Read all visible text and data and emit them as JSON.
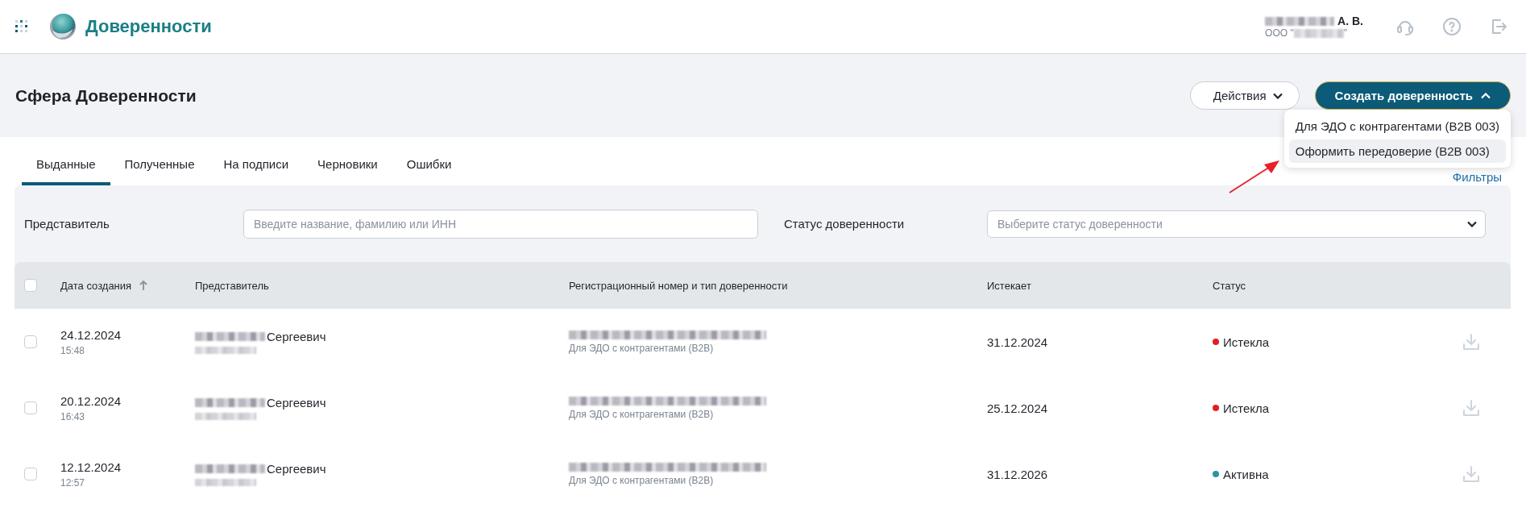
{
  "header": {
    "app_title": "Доверенности",
    "user": {
      "name": "А. В.",
      "org_prefix": "ООО \"",
      "org_suffix": "\""
    }
  },
  "page_title": "Сфера Доверенности",
  "actions_button": {
    "label": "Действия"
  },
  "create_button": {
    "label": "Создать доверенность",
    "expanded": true
  },
  "create_menu": [
    {
      "label": "Для ЭДО с контрагентами (B2B 003)",
      "selected": false
    },
    {
      "label": "Оформить передоверие (B2B 003)",
      "selected": true
    }
  ],
  "tabs": [
    {
      "label": "Выданные",
      "selected": true
    },
    {
      "label": "Полученные",
      "selected": false
    },
    {
      "label": "На подписи",
      "selected": false
    },
    {
      "label": "Черновики",
      "selected": false
    },
    {
      "label": "Ошибки",
      "selected": false
    }
  ],
  "filters_link": "Фильтры",
  "filters": {
    "representative": {
      "label": "Представитель",
      "placeholder": "Введите название, фамилию или ИНН"
    },
    "status": {
      "label": "Статус доверенности",
      "placeholder": "Выберите статус доверенности"
    }
  },
  "table": {
    "select_all_checked": false,
    "columns": [
      {
        "label": "Дата создания",
        "sorted": true
      },
      {
        "label": "Представитель",
        "sorted": false
      },
      {
        "label": "Регистрационный номер и тип доверенности",
        "sorted": false
      },
      {
        "label": "Истекает",
        "sorted": false
      },
      {
        "label": "Статус",
        "sorted": false
      }
    ],
    "rows": [
      {
        "checked": false,
        "date": "24.12.2024",
        "time": "15:48",
        "representative": "Сергеевич",
        "type": "Для ЭДО с контрагентами (B2B)",
        "expires": "31.12.2024",
        "status": "Истекла",
        "color": "#e31e24"
      },
      {
        "checked": false,
        "date": "20.12.2024",
        "time": "16:43",
        "representative": "Сергеевич",
        "type": "Для ЭДО с контрагентами (B2B)",
        "expires": "25.12.2024",
        "status": "Истекла",
        "color": "#e31e24"
      },
      {
        "checked": false,
        "date": "12.12.2024",
        "time": "12:57",
        "representative": "Сергеевич",
        "type": "Для ЭДО с контрагентами (B2B)",
        "expires": "31.12.2026",
        "status": "Активна",
        "color": "#2a93a6"
      }
    ]
  }
}
